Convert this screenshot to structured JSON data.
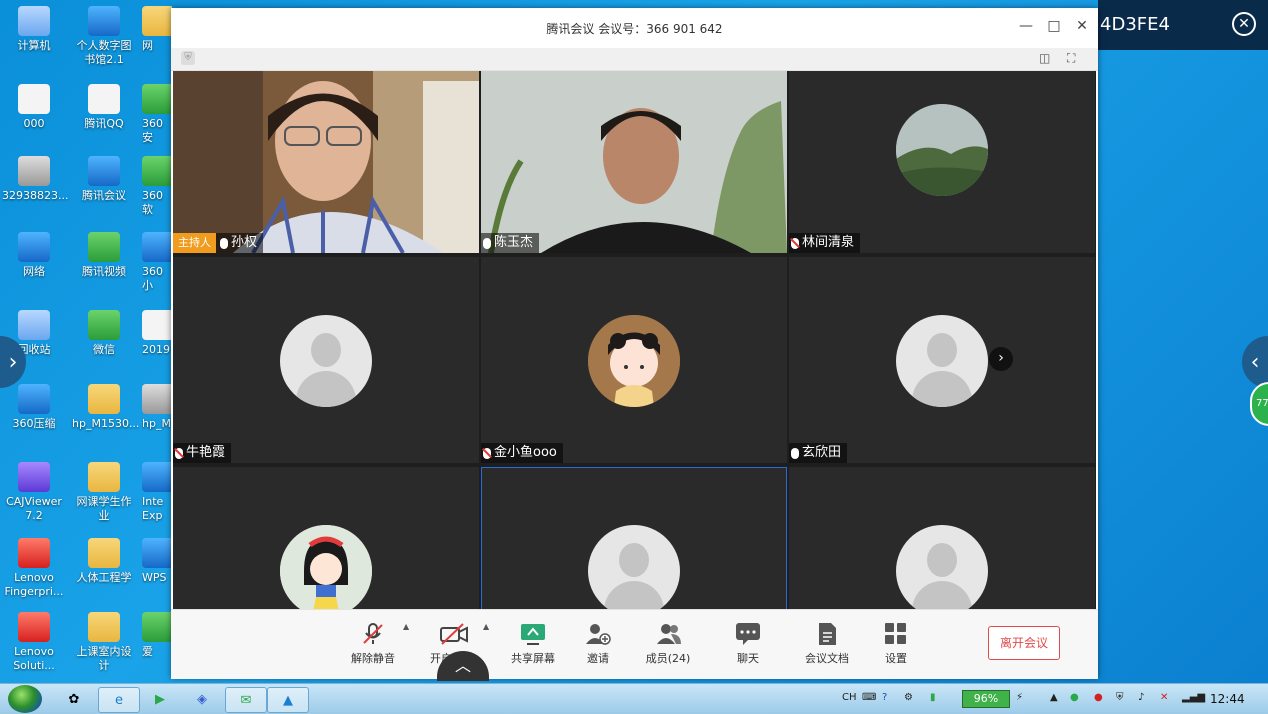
{
  "desktop": {
    "col1": [
      "计算机",
      "000",
      "32938823...",
      "网络",
      "回收站",
      "360压缩",
      "CAJViewer 7.2",
      "Lenovo Fingerpri...",
      "Lenovo Soluti..."
    ],
    "col2": [
      "个人数字图书馆2.1",
      "腾讯QQ",
      "腾讯会议",
      "腾讯视频",
      "微信",
      "hp_M1530...",
      "网课学生作业",
      "人体工程学",
      "上课室内设计"
    ],
    "col3": [
      "网",
      "360安",
      "360软",
      "360小",
      "2019",
      "hp_M",
      "Inte Exp",
      "WPS",
      "爱"
    ]
  },
  "right_strip": {
    "text": "4D3FE4",
    "close": "✕"
  },
  "window": {
    "title": "腾讯会议 会议号：366 901 642",
    "minimize": "—",
    "maximize": "□",
    "close": "✕"
  },
  "participants": [
    {
      "name": "孙权",
      "host_label": "主持人",
      "mic": "on"
    },
    {
      "name": "陈玉杰",
      "mic": "on"
    },
    {
      "name": "林间清泉",
      "mic": "off"
    },
    {
      "name": "牛艳霞",
      "mic": "off"
    },
    {
      "name": "金小鱼ooo",
      "mic": "off"
    },
    {
      "name": "玄欣田",
      "mic": "on"
    },
    {
      "name": "",
      "mic": ""
    },
    {
      "name": "",
      "mic": ""
    },
    {
      "name": "",
      "mic": ""
    }
  ],
  "toolbar": {
    "mute": "解除静音",
    "video": "开启视频",
    "share": "共享屏幕",
    "invite": "邀请",
    "members": "成员(24)",
    "chat": "聊天",
    "docs": "会议文档",
    "settings": "设置",
    "leave": "离开会议"
  },
  "taskbar": {
    "lang": "CH",
    "battery": "96%",
    "time": "12:44"
  },
  "side_badge": "77",
  "colors": {
    "host": "#f29c1f",
    "leave": "#e04a4a",
    "selected": "#2a6ad8"
  }
}
